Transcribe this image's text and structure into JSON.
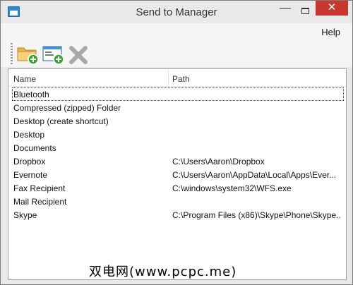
{
  "window": {
    "title": "Send to Manager",
    "minimize_glyph": "—",
    "close_glyph": "✕"
  },
  "menu": {
    "help": "Help"
  },
  "toolbar": {
    "buttons": [
      {
        "icon": "add-folder-icon"
      },
      {
        "icon": "add-application-icon"
      },
      {
        "icon": "delete-icon"
      }
    ]
  },
  "list": {
    "columns": [
      "Name",
      "Path"
    ],
    "rows": [
      {
        "name": "Bluetooth",
        "path": ""
      },
      {
        "name": "Compressed (zipped) Folder",
        "path": ""
      },
      {
        "name": "Desktop (create shortcut)",
        "path": ""
      },
      {
        "name": "Desktop",
        "path": ""
      },
      {
        "name": "Documents",
        "path": ""
      },
      {
        "name": "Dropbox",
        "path": "C:\\Users\\Aaron\\Dropbox"
      },
      {
        "name": "Evernote",
        "path": "C:\\Users\\Aaron\\AppData\\Local\\Apps\\Ever..."
      },
      {
        "name": "Fax Recipient",
        "path": "C:\\windows\\system32\\WFS.exe"
      },
      {
        "name": "Mail Recipient",
        "path": ""
      },
      {
        "name": "Skype",
        "path": "C:\\Program Files (x86)\\Skype\\Phone\\Skype...."
      }
    ]
  },
  "watermark": "双电网(www.pcpc.me)",
  "colors": {
    "close_button": "#c7372f",
    "window_bg": "#e9e9e9",
    "folder_yellow": "#f2c94c",
    "add_green": "#3aa335"
  }
}
